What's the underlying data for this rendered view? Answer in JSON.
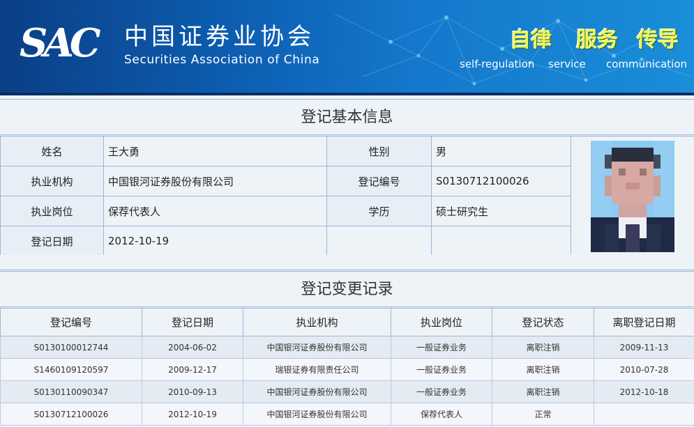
{
  "header": {
    "logo_text": "SAC",
    "org_name_cn": "中国证券业协会",
    "org_name_en": "Securities Association of China",
    "slogans": [
      {
        "cn": "自律",
        "en": "self-regulation"
      },
      {
        "cn": "服务",
        "en": "service"
      },
      {
        "cn": "传导",
        "en": "communication"
      }
    ]
  },
  "basic_info": {
    "title": "登记基本信息",
    "name_label": "姓名",
    "name_value": "王大勇",
    "gender_label": "性别",
    "gender_value": "男",
    "institution_label": "执业机构",
    "institution_value": "中国银河证券股份有限公司",
    "reg_no_label": "登记编号",
    "reg_no_value": "S0130712100026",
    "position_label": "执业岗位",
    "position_value": "保荐代表人",
    "education_label": "学历",
    "education_value": "硕士研究生",
    "reg_date_label": "登记日期",
    "reg_date_value": "2012-10-19"
  },
  "change_records": {
    "title": "登记变更记录",
    "columns": [
      "登记编号",
      "登记日期",
      "执业机构",
      "执业岗位",
      "登记状态",
      "离职登记日期"
    ],
    "rows": [
      [
        "S0130100012744",
        "2004-06-02",
        "中国银河证券股份有限公司",
        "一般证券业务",
        "离职注销",
        "2009-11-13"
      ],
      [
        "S1460109120597",
        "2009-12-17",
        "瑞银证券有限责任公司",
        "一般证券业务",
        "离职注销",
        "2010-07-28"
      ],
      [
        "S0130110090347",
        "2010-09-13",
        "中国银河证券股份有限公司",
        "一般证券业务",
        "离职注销",
        "2012-10-18"
      ],
      [
        "S0130712100026",
        "2012-10-19",
        "中国银河证券股份有限公司",
        "保荐代表人",
        "正常",
        ""
      ]
    ]
  }
}
